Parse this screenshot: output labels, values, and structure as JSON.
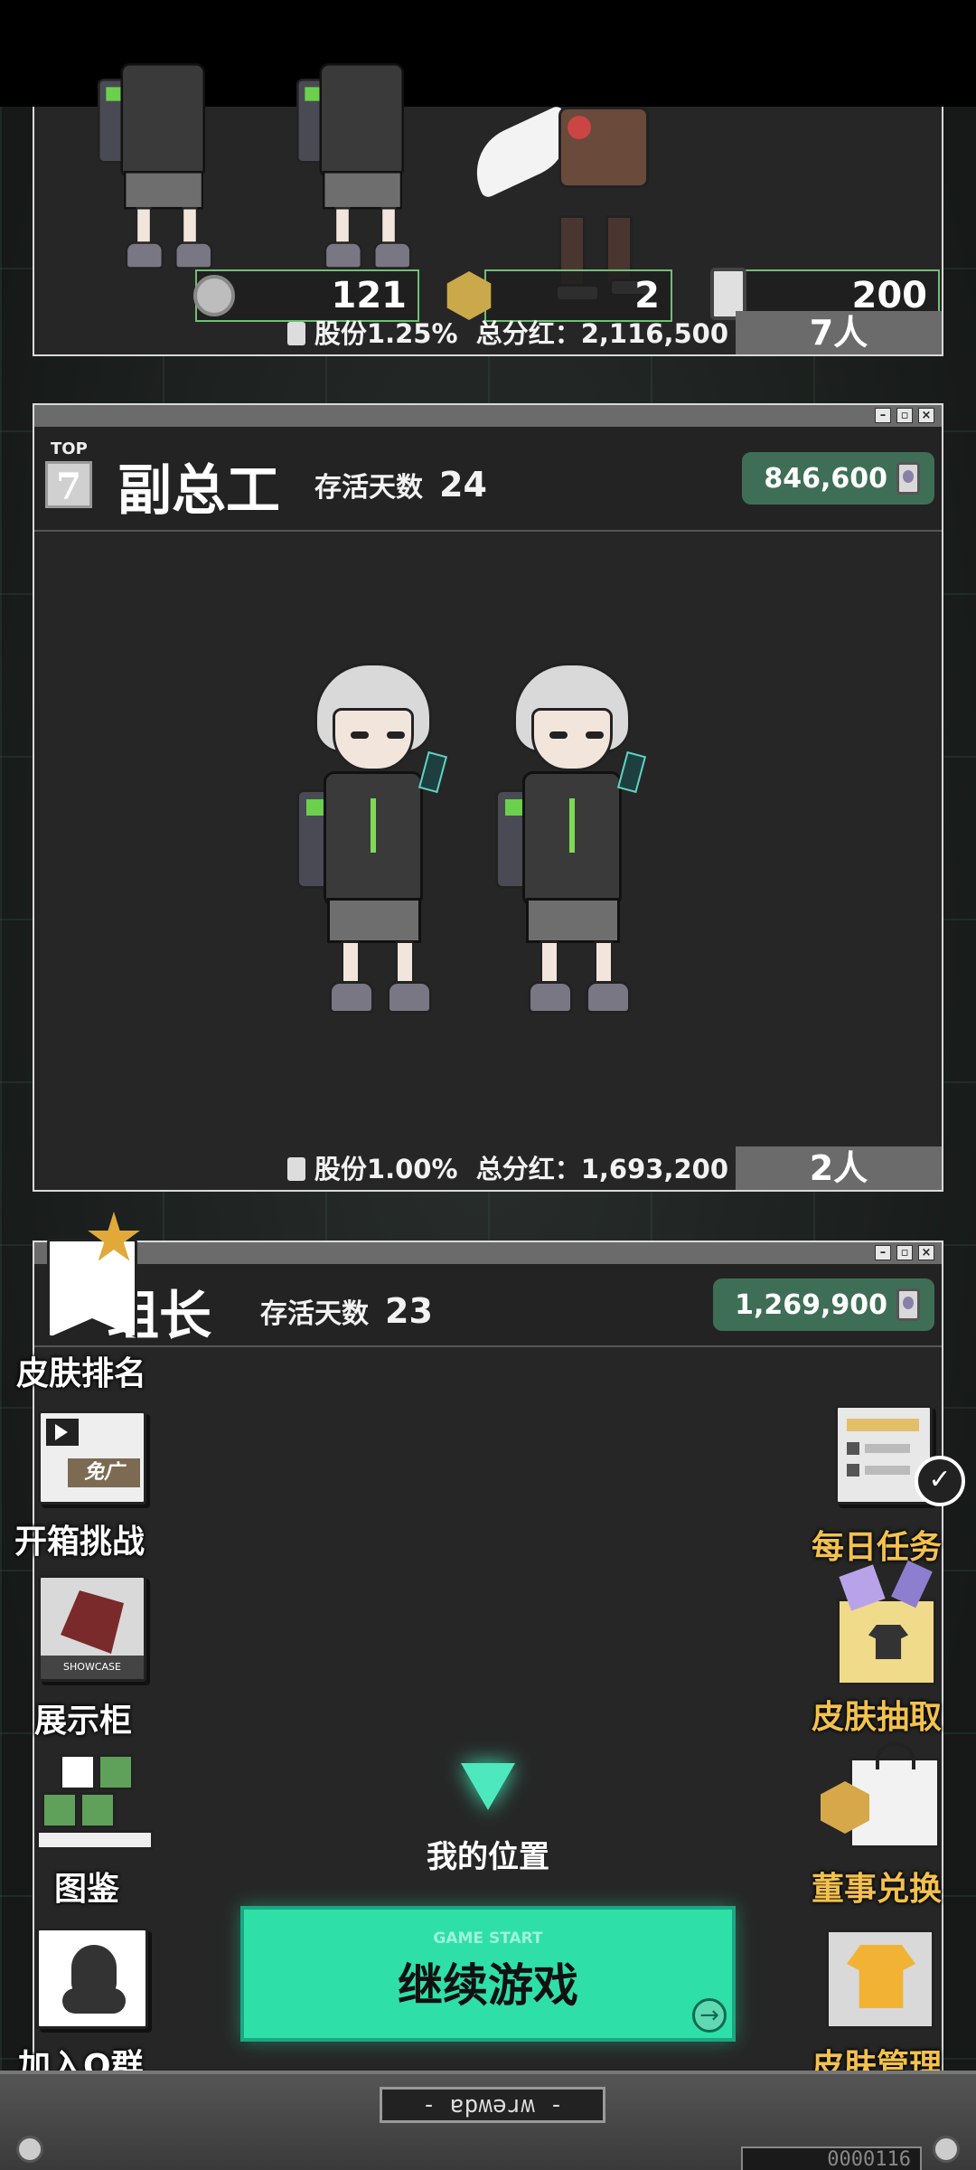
{
  "top_panel": {
    "resources": {
      "coins": "121",
      "badges": "2",
      "cards": "200"
    },
    "shares": "股份1.25%",
    "dividend": "总分红：2,116,500",
    "count": "7人"
  },
  "panel_vice": {
    "top_label": "TOP",
    "rank": "7",
    "title": "副总工",
    "survive_label": "存活天数",
    "survive_days": "24",
    "money": "846,600",
    "shares": "股份1.00%",
    "dividend": "总分红：1,693,200",
    "count": "2人"
  },
  "panel_leader": {
    "title": "组长",
    "survive_label": "存活天数",
    "survive_days": "23",
    "money": "1,269,900"
  },
  "left_menu": {
    "skin_rank": "皮肤排名",
    "box_challenge": "开箱挑战",
    "ad_free": "免广",
    "showcase": "展示柜",
    "showcase_tag": "SHOWCASE",
    "codex": "图鉴",
    "join_group": "加入Q群"
  },
  "right_menu": {
    "daily_tasks": "每日任务",
    "skin_draw": "皮肤抽取",
    "board_exchange": "董事兑换",
    "skin_manage": "皮肤管理"
  },
  "bottom": {
    "my_position": "我的位置",
    "start_sub": "GAME START",
    "start_main": "继续游戏",
    "console_plate": "- ɐpʍǝɹʍ -",
    "console_id": "0000116"
  },
  "colors": {
    "accent_green": "#2ee0a8",
    "money_pill": "#3f6e57",
    "gold_label": "#f2c14e"
  }
}
